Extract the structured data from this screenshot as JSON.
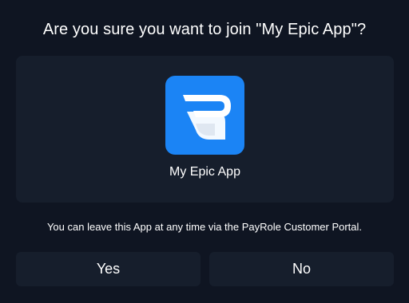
{
  "dialog": {
    "title": "Are you sure you want to join \"My Epic App\"?",
    "notice": "You can leave this App at any time via the PayRole Customer Portal.",
    "yes_label": "Yes",
    "no_label": "No"
  },
  "app": {
    "name": "My Epic App",
    "icon": "app-logo-icon"
  },
  "colors": {
    "background": "#0f1522",
    "card": "#161e2c",
    "app_icon_bg": "#1b84f5",
    "text": "#ffffff"
  }
}
